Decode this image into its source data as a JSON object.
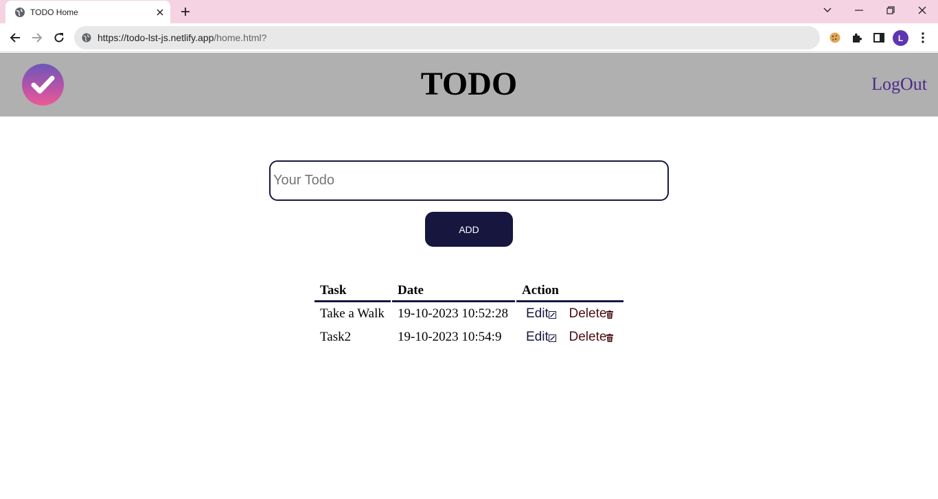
{
  "browser": {
    "tab_title": "TODO Home",
    "url_host": "https://todo-lst-js.netlify.app",
    "url_path": "/home.html?",
    "profile_initial": "L"
  },
  "header": {
    "title": "TODO",
    "logout_label": "LogOut",
    "logo_icon": "check-circle-icon"
  },
  "form": {
    "placeholder": "Your Todo",
    "value": "",
    "add_label": "ADD"
  },
  "table": {
    "columns": [
      "Task",
      "Date",
      "Action"
    ],
    "rows": [
      {
        "task": "Take a Walk",
        "date": "19-10-2023 10:52:28",
        "edit": "Edit",
        "delete": "Delete"
      },
      {
        "task": "Task2",
        "date": "19-10-2023 10:54:9",
        "edit": "Edit",
        "delete": "Delete"
      }
    ]
  },
  "colors": {
    "header_bg": "#b0b0b0",
    "accent": "#16163f",
    "logout": "#4b2a8a",
    "delete": "#4a0e12",
    "tabstrip": "#f6d3e2"
  }
}
